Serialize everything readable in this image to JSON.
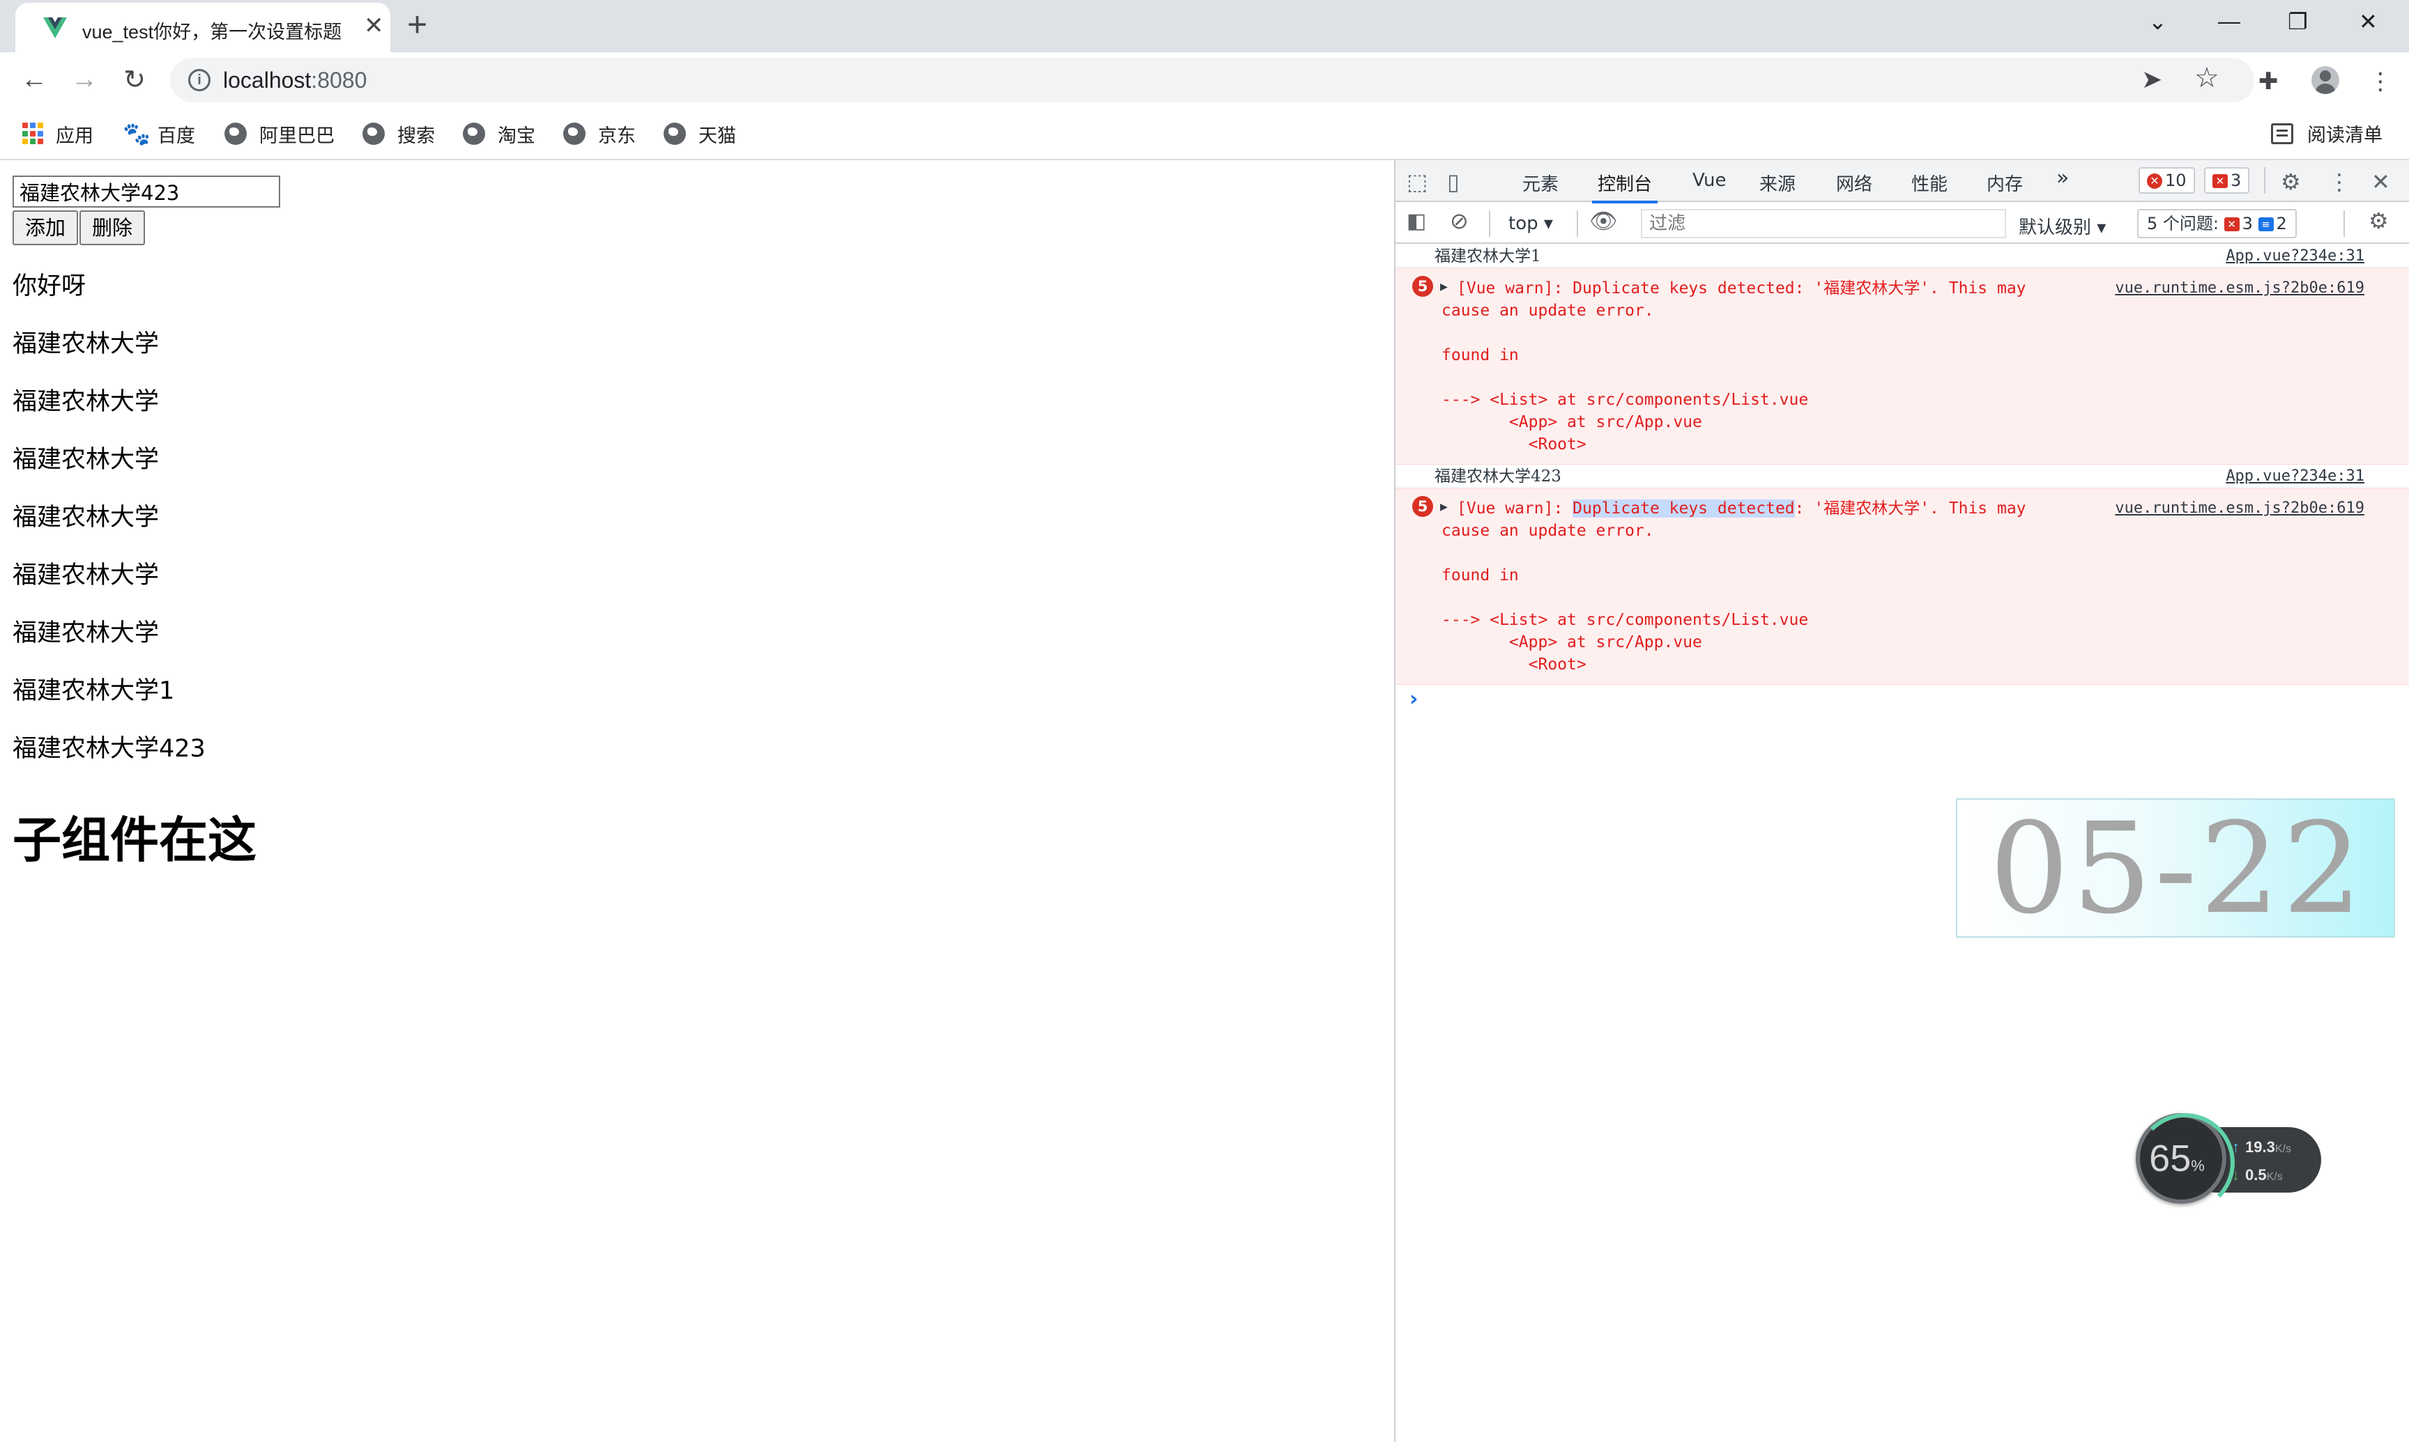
{
  "browser": {
    "tab": {
      "title": "vue_test你好，第一次设置标题",
      "close": "✕",
      "favicon": "vue-logo-icon"
    },
    "new_tab": "+",
    "window_controls": {
      "dropdown": "⌄",
      "minimize": "—",
      "restore": "❐",
      "close": "✕"
    },
    "nav": {
      "back": "←",
      "forward": "→",
      "reload": "↻"
    },
    "address": {
      "host": "localhost",
      "port": ":8080",
      "info": "i"
    },
    "bookmarks": [
      {
        "label": "应用",
        "icon": "apps-grid-icon"
      },
      {
        "label": "百度",
        "icon": "baidu-paw-icon"
      },
      {
        "label": "阿里巴巴",
        "icon": "globe-icon"
      },
      {
        "label": "搜索",
        "icon": "globe-icon"
      },
      {
        "label": "淘宝",
        "icon": "globe-icon"
      },
      {
        "label": "京东",
        "icon": "globe-icon"
      },
      {
        "label": "天猫",
        "icon": "globe-icon"
      }
    ],
    "reading_list": "阅读清单",
    "accent": "#1a73e8"
  },
  "page": {
    "input_value": "福建农林大学423",
    "add_button": "添加",
    "delete_button": "删除",
    "items": [
      "你好呀",
      "福建农林大学",
      "福建农林大学",
      "福建农林大学",
      "福建农林大学",
      "福建农林大学",
      "福建农林大学",
      "福建农林大学1",
      "福建农林大学423"
    ],
    "heading": "子组件在这"
  },
  "devtools": {
    "tabs": [
      "元素",
      "控制台",
      "Vue",
      "来源",
      "网络",
      "性能",
      "内存"
    ],
    "active_tab": "控制台",
    "more": "»",
    "error_count": "10",
    "issue_count": "3",
    "context": "top",
    "filter_placeholder": "过滤",
    "levels": "默认级别",
    "issues_label": "5 个问题:",
    "issues_errors": "3",
    "issues_info": "2",
    "console": {
      "log1": {
        "text": "福建农林大学1",
        "source": "App.vue?234e:31"
      },
      "warn1": {
        "count": "5",
        "line1_prefix": "[Vue warn]: ",
        "line1_highlight": "",
        "line1_rest": "Duplicate keys detected: '福建农林大学'. This may",
        "line2": "cause an update error.",
        "line3": "found in",
        "line4": "---> <List> at src/components/List.vue",
        "line5": "       <App> at src/App.vue",
        "line6": "         <Root>",
        "source": "vue.runtime.esm.js?2b0e:619"
      },
      "log2": {
        "text": "福建农林大学423",
        "source": "App.vue?234e:31"
      },
      "warn2": {
        "count": "5",
        "line1_prefix": "[Vue warn]: ",
        "line1_highlight": "Duplicate keys detected",
        "line1_rest": ": '福建农林大学'. This may",
        "line2": "cause an update error.",
        "line3": "found in",
        "line4": "---> <List> at src/components/List.vue",
        "line5": "       <App> at src/App.vue",
        "line6": "         <Root>",
        "source": "vue.runtime.esm.js?2b0e:619"
      },
      "prompt": "›"
    }
  },
  "overlays": {
    "date": "05-22",
    "speed": {
      "percent": "65",
      "percent_unit": "%",
      "up": "19.3",
      "down": "0.5",
      "unit": "K/s"
    }
  }
}
